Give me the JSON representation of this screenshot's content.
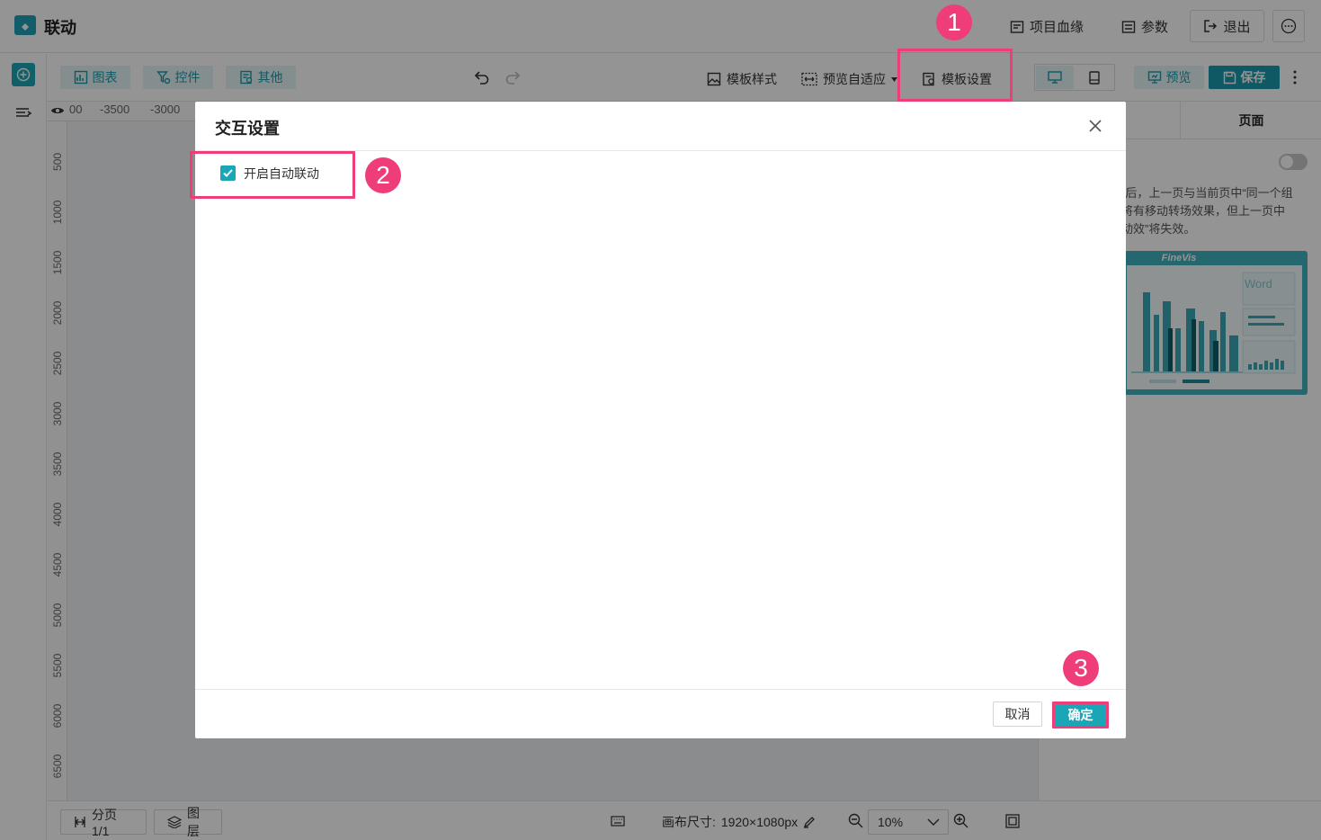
{
  "app": {
    "title": "联动"
  },
  "header": {
    "lineage_label": "项目血缘",
    "params_label": "参数",
    "exit_label": "退出"
  },
  "toolbar": {
    "chart_label": "图表",
    "control_label": "控件",
    "other_label": "其他",
    "template_style_label": "模板样式",
    "preview_fit_label": "预览自适应",
    "template_settings_label": "模板设置",
    "preview_label": "预览",
    "save_label": "保存"
  },
  "ruler": {
    "top_labels": [
      "00",
      "-3500",
      "-3000"
    ],
    "left_labels": [
      "500",
      "1000",
      "1500",
      "2000",
      "2500",
      "3000",
      "3500",
      "4000",
      "4500",
      "5000",
      "5500",
      "6000",
      "6500"
    ]
  },
  "right_panel": {
    "tab_label": "页面",
    "description_lines": [
      "”后，上一页与当前页中“同一个组",
      "将有移动转场效果，但上一页中",
      "动效”将失效。"
    ],
    "preview_brand": "FineVis",
    "preview_word": "Word"
  },
  "statusbar": {
    "page_label": "分页1/1",
    "layer_label": "图层",
    "canvas_size_label": "画布尺寸:",
    "canvas_size_value": "1920×1080px",
    "zoom_value": "10%"
  },
  "dialog": {
    "title": "交互设置",
    "auto_link_label": "开启自动联动",
    "auto_link_checked": true,
    "cancel_label": "取消",
    "confirm_label": "确定"
  },
  "annotations": {
    "step1": "1",
    "step2": "2",
    "step3": "3"
  },
  "colors": {
    "accent": "#1aa6b6",
    "annotation": "#ee3d78"
  }
}
